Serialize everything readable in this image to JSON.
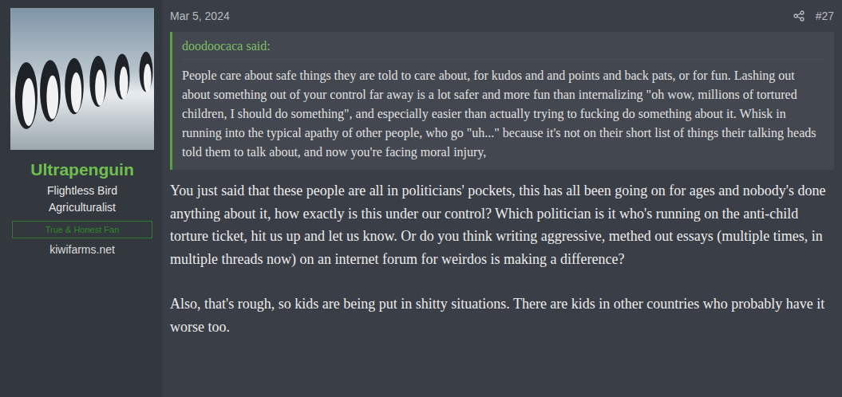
{
  "post": {
    "date": "Mar 5, 2024",
    "number": "#27"
  },
  "author": {
    "name": "Ultrapenguin",
    "title": "Flightless Bird Agriculturalist",
    "badge": "True & Honest Fan",
    "site": "kiwifarms.net"
  },
  "quote": {
    "author_line": "doodoocaca said:",
    "text": "People care about safe things they are told to care about, for kudos and and points and back pats, or for fun. Lashing out about something out of your control far away is a lot safer and more fun than internalizing \"oh wow, millions of tortured children, I should do something\", and especially easier than actually trying to fucking do something about it. Whisk in running into the typical apathy of other people, who go \"uh...\" because it's not on their short list of things their talking heads told them to talk about, and now you're facing moral injury,"
  },
  "body": [
    "You just said that these people are all in politicians' pockets, this has all been going on for ages and nobody's done anything about it, how exactly is this under our control? Which politician is it who's running on the anti-child torture ticket, hit us up and let us know. Or do you think writing aggressive, methed out essays (multiple times, in multiple threads now) on an internet forum for weirdos is making a difference?",
    "Also, that's rough, so kids are being put in shitty situations. There are kids in other countries who probably have it worse too."
  ]
}
